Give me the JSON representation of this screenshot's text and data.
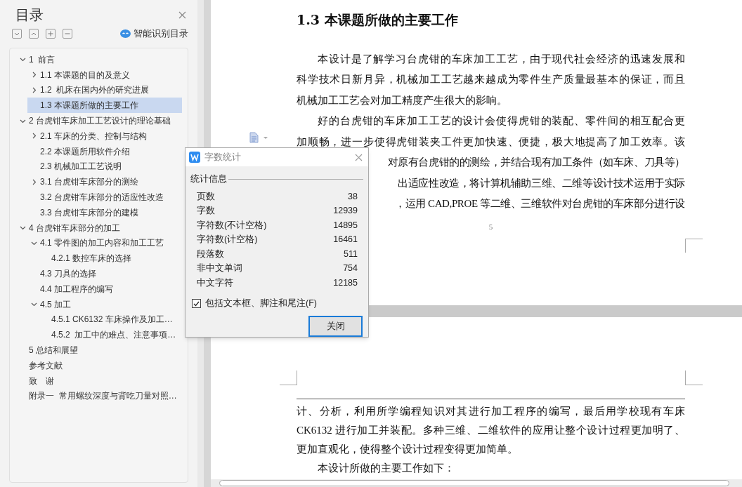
{
  "sidebar": {
    "title": "目录",
    "smart_toc_label": "智能识别目录",
    "tree": [
      {
        "label": "1  前言",
        "expanded": true,
        "selected": false,
        "children": [
          {
            "label": "1.1 本课题的目的及意义",
            "expanded": false,
            "selected": false
          },
          {
            "label": "1.2  机床在国内外的研究进展",
            "expanded": false,
            "selected": false
          },
          {
            "label": "1.3 本课题所做的主要工作",
            "selected": true
          }
        ]
      },
      {
        "label": "2 台虎钳车床加工工艺设计的理论基础",
        "expanded": true,
        "selected": false,
        "children": [
          {
            "label": "2.1 车床的分类、控制与结构",
            "expanded": false,
            "selected": false
          },
          {
            "label": "2.2 本课题所用软件介绍",
            "selected": false
          },
          {
            "label": "2.3 机械加工工艺说明",
            "selected": false
          },
          {
            "label": "3.1 台虎钳车床部分的测绘",
            "expanded": false,
            "selected": false
          },
          {
            "label": "3.2 台虎钳车床部分的适应性改造",
            "selected": false
          },
          {
            "label": "3.3 台虎钳车床部分的建模",
            "selected": false
          }
        ]
      },
      {
        "label": "4 台虎钳车床部分的加工",
        "expanded": true,
        "selected": false,
        "children": [
          {
            "label": "4.1 零件图的加工内容和加工工艺",
            "expanded": true,
            "selected": false,
            "children": [
              {
                "label": "4.2.1 数控车床的选择",
                "selected": false
              }
            ]
          },
          {
            "label": "4.3 刀具的选择",
            "selected": false
          },
          {
            "label": "4.4 加工程序的编写",
            "selected": false
          },
          {
            "label": "4.5 加工",
            "expanded": true,
            "selected": false,
            "children": [
              {
                "label": "4.5.1 CK6132 车床操作及加工…",
                "selected": false
              },
              {
                "label": "4.5.2  加工中的难点、注意事项…",
                "selected": false
              }
            ]
          }
        ]
      },
      {
        "label": "5 总结和展望",
        "selected": false
      },
      {
        "label": "参考文献",
        "selected": false
      },
      {
        "label": "致　谢",
        "selected": false
      },
      {
        "label": "附录一  常用螺纹深度与背吃刀量对照…",
        "selected": false
      }
    ]
  },
  "document": {
    "page_1": {
      "heading": "1.3 本课题所做的主要工作",
      "lines": [
        {
          "kind": "indent",
          "text": "本设计是了解学习台虎钳的车床加工工艺，由于现代社会经济的迅速发展和"
        },
        {
          "kind": "full",
          "text": "科学技术日新月异，机械加工工艺越来越成为零件生产质量最基本的保证，而且"
        },
        {
          "kind": "last",
          "text": "机械加工工艺会对加工精度产生很大的影响。"
        },
        {
          "kind": "indent",
          "text": "好的台虎钳的车床加工工艺的设计会使得虎钳的装配、零件间的相互配合更"
        },
        {
          "kind": "full",
          "text": "加顺畅，进一步使得虎钳装夹工件更加快速、便捷，极大地提高了加工效率。该"
        },
        {
          "kind": "covered",
          "text": "对原有台虎钳的的测绘，并结合现有加工条件（如车床、刀具等）"
        },
        {
          "kind": "covered",
          "text": "出适应性改造，将计算机辅助三维、二维等设计技术运用于实际"
        },
        {
          "kind": "covered",
          "text": "，运用 CAD,PROE 等二维、三维软件对台虎钳的车床部分进行设"
        }
      ],
      "page_number": "5"
    },
    "page_2": {
      "lines": [
        {
          "kind": "full",
          "text": "计、分析，利用所学编程知识对其进行加工程序的编写，最后用学校现有车床"
        },
        {
          "kind": "full",
          "text": "CK6132 进行加工并装配。多种三维、二维软件的应用让整个设计过程更加明了、"
        },
        {
          "kind": "last",
          "text": "更加直观化，使得整个设计过程变得更加简单。"
        },
        {
          "kind": "indent",
          "text": "本设计所做的主要工作如下："
        }
      ]
    }
  },
  "dialog": {
    "title": "字数统计",
    "group_label": "统计信息",
    "stats": [
      {
        "label": "页数",
        "value": "38"
      },
      {
        "label": "字数",
        "value": "12939"
      },
      {
        "label": "字符数(不计空格)",
        "value": "14895"
      },
      {
        "label": "字符数(计空格)",
        "value": "16461"
      },
      {
        "label": "段落数",
        "value": "511"
      },
      {
        "label": "非中文单词",
        "value": "754"
      },
      {
        "label": "中文字符",
        "value": "12185"
      }
    ],
    "checkbox": {
      "label": "包括文本框、脚注和尾注(F)",
      "checked": true
    },
    "close_button": "关闭"
  }
}
